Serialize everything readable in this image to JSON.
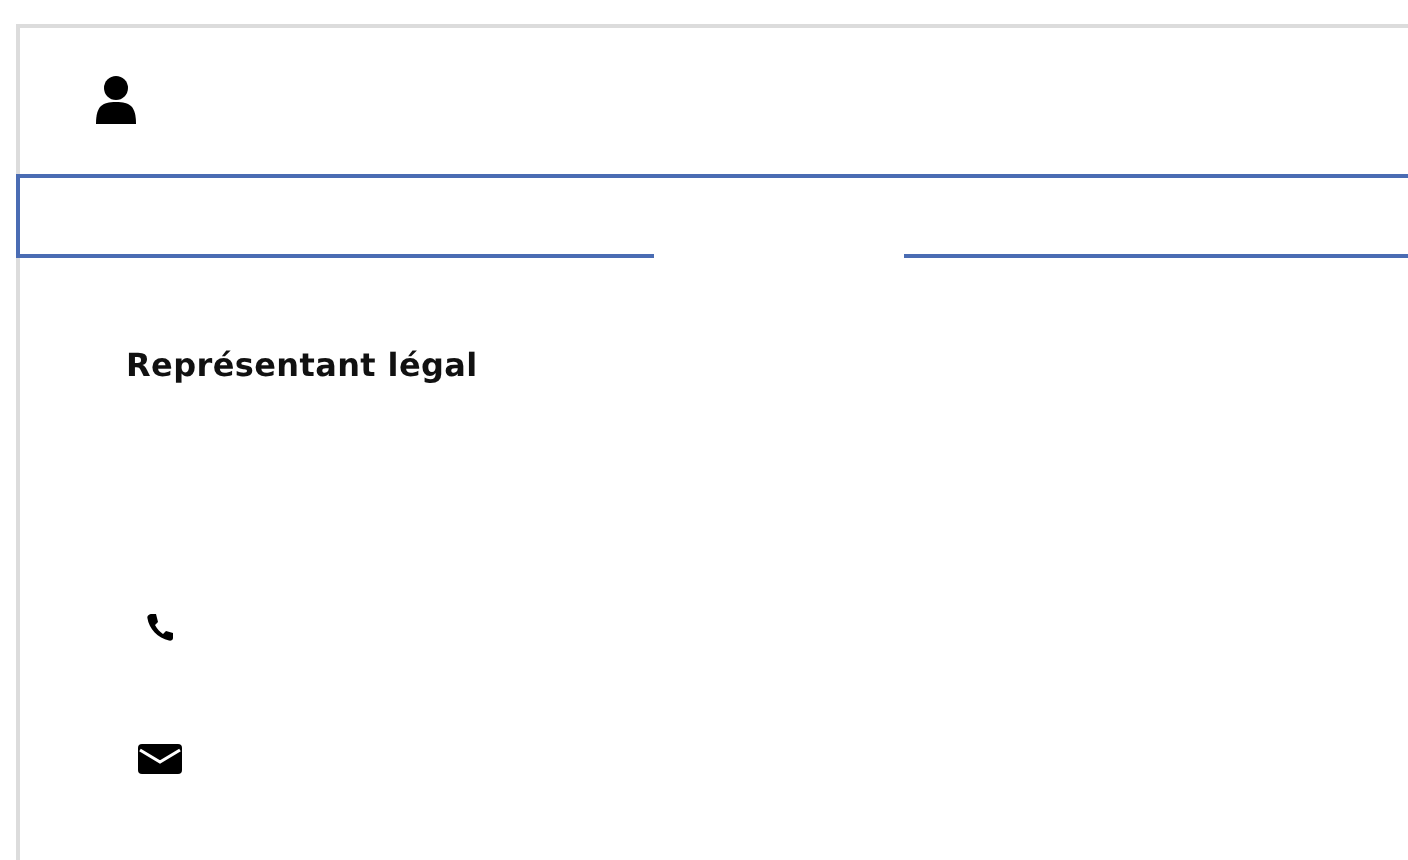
{
  "section": {
    "title": "Représentant légal"
  }
}
